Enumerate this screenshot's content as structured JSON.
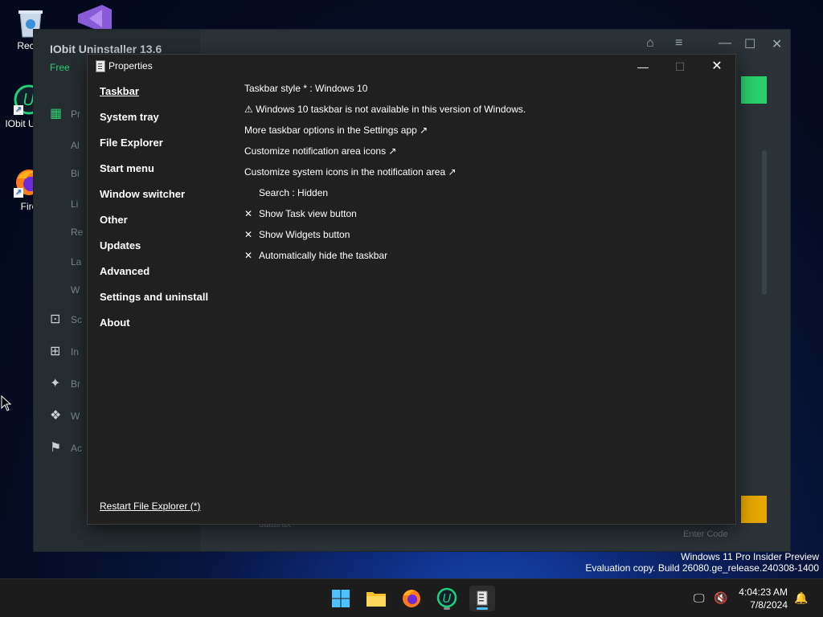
{
  "desktop": {
    "icons": [
      {
        "label": "Recyc",
        "icon": "recycle-bin-icon"
      },
      {
        "label": "IObit Unins",
        "icon": "iobit-uninstaller-icon"
      },
      {
        "label": "Fire",
        "icon": "firefox-icon"
      }
    ]
  },
  "iobit": {
    "title": "IObit Uninstaller 13.6",
    "free": "Free",
    "nav_letters": [
      "Pr",
      "Al",
      "Bi",
      "Li",
      "Re",
      "La",
      "W",
      "Sc",
      "In",
      "Br",
      "W",
      "Ac"
    ],
    "bottom_text": "datatrax",
    "enter_code": "Enter Code"
  },
  "properties": {
    "title": "Properties",
    "minimize": "—",
    "maximize": "☐",
    "close": "✕",
    "nav": [
      "Taskbar",
      "System tray",
      "File Explorer",
      "Start menu",
      "Window switcher",
      "Other",
      "Updates",
      "Advanced",
      "Settings and uninstall",
      "About"
    ],
    "restart": "Restart File Explorer (*)",
    "options": {
      "taskbar_style": "Taskbar style * : Windows 10",
      "warning": "⚠ Windows 10 taskbar is not available in this version of Windows.",
      "more_options": "More taskbar options in the Settings app ↗",
      "customize_notif": "Customize notification area icons ↗",
      "customize_system": "Customize system icons in the notification area ↗",
      "search": "Search : Hidden",
      "task_view": "Show Task view button",
      "widgets": "Show Widgets button",
      "autohide": "Automatically hide the taskbar",
      "check_mark": "✕"
    }
  },
  "watermark": {
    "line1": "Windows 11 Pro Insider Preview",
    "line2": "Evaluation copy. Build 26080.ge_release.240308-1400"
  },
  "taskbar": {
    "time": "4:04:23 AM",
    "date": "7/8/2024",
    "apps": [
      "start-icon",
      "file-explorer-icon",
      "firefox-icon",
      "iobit-icon",
      "properties-app-icon"
    ]
  }
}
